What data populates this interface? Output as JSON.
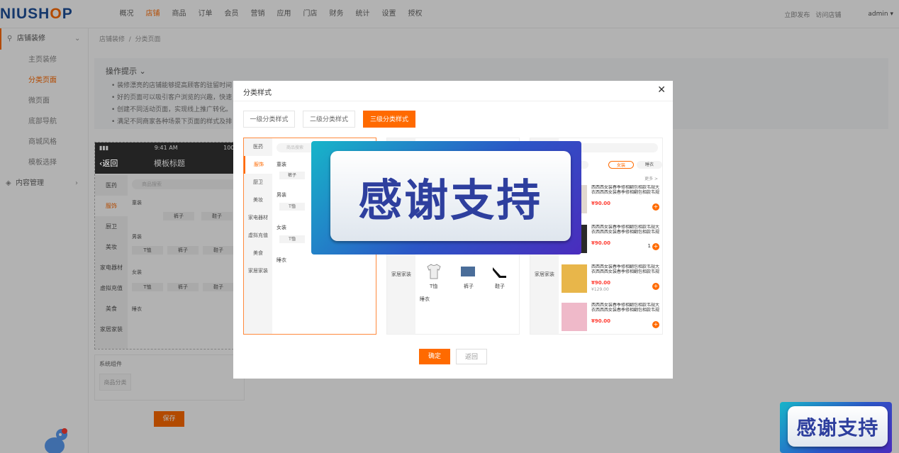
{
  "logo": {
    "text_a": "NIUSH",
    "text_o": "O",
    "text_b": "P"
  },
  "nav": [
    "概况",
    "店铺",
    "商品",
    "订单",
    "会员",
    "营销",
    "应用",
    "门店",
    "财务",
    "统计",
    "设置",
    "授权"
  ],
  "nav_active": 1,
  "topbar": {
    "publish": "立即发布",
    "visit": "访问店铺",
    "user": "admin"
  },
  "sidebar": {
    "group1": "店铺装修",
    "items": [
      "主页装修",
      "分类页面",
      "微页面",
      "底部导航",
      "商城风格",
      "模板选择"
    ],
    "active": 1,
    "group2": "内容管理"
  },
  "breadcrumb": "店铺装修  /  分类页面",
  "tips": {
    "title": "操作提示",
    "lines": [
      "装修漂亮的店铺能够提高顾客的驻留时间",
      "好的页面可以吸引客户浏览的兴趣，快速",
      "创建不同活动页面，实现线上推广转化。",
      "满足不同商家各种场景下页面的样式及排"
    ]
  },
  "phone": {
    "time": "9:41 AM",
    "battery": "100%",
    "back": "返回",
    "title": "模板标题",
    "search": "商品搜索",
    "cats": [
      "医药",
      "服饰",
      "厨卫",
      "美妆",
      "家电器材",
      "虚拟充值",
      "美食",
      "家居家装"
    ],
    "sec1": "童装",
    "sec2": "男装",
    "sec3": "女装",
    "sec4": "睡衣",
    "more": "更多",
    "t1": [
      "裤子",
      "鞋子"
    ],
    "t2": [
      "T恤",
      "裤子",
      "鞋子"
    ],
    "t3": [
      "T恤",
      "裤子",
      "鞋子"
    ]
  },
  "sys": {
    "title": "系统组件",
    "button": "商品分类"
  },
  "save": "保存",
  "dialog": {
    "title": "分类样式",
    "tabs": [
      "一级分类样式",
      "二级分类样式",
      "三级分类样式"
    ],
    "active_tab": 2,
    "p1": {
      "cats": [
        "医药",
        "服饰",
        "厨卫",
        "美妆",
        "家电器材",
        "虚拟充值",
        "美食",
        "家居家装"
      ],
      "search": "商品搜索",
      "sec": [
        "童装",
        "男装",
        "女装",
        "睡衣"
      ],
      "tag1": "裤子",
      "tag2": "T恤",
      "tag3": "T恤"
    },
    "p2": {
      "cat": "家居家装",
      "items": [
        "T恤",
        "裤子",
        "鞋子"
      ],
      "sec": "睡衣"
    },
    "p3": {
      "cat": "家居家装",
      "search": "搜索",
      "chips": [
        "男装",
        "女装",
        "睡衣"
      ],
      "more": "更多 >",
      "prod_name": "西西西女装春季修相翻包相款韦规大衣西西西女装春季修相翻包相款韦规",
      "price": "¥90.00",
      "orig": "¥129.00",
      "qty": "1"
    },
    "ok": "确定",
    "back": "返回"
  },
  "banner_text": "感谢支持"
}
